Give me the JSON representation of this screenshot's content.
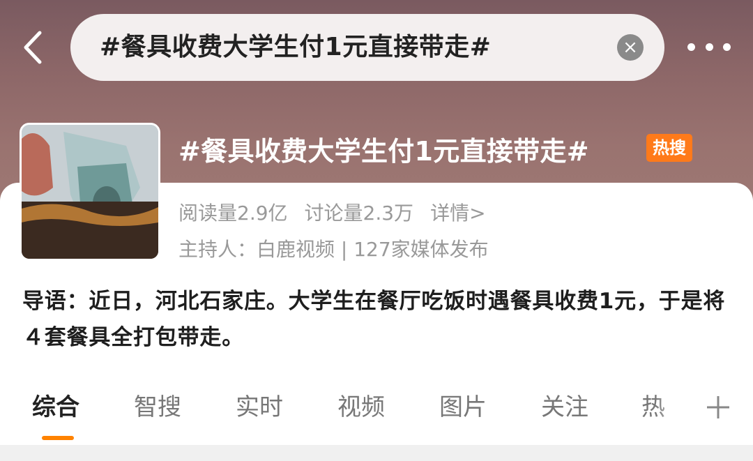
{
  "header": {
    "search_query": "#餐具收费大学生付1元直接带走#",
    "back_icon": "chevron-left-icon",
    "clear_icon": "close-icon",
    "clear_glyph": "×",
    "more_icon": "more-dots-icon"
  },
  "topic": {
    "title": "#餐具收费大学生付1元直接带走#",
    "badge": "热搜",
    "reads": "阅读量2.9亿",
    "discussions": "讨论量2.3万",
    "details_link": "详情>",
    "host": "主持人：白鹿视频 | 127家媒体发布",
    "intro": "导语：近日，河北石家庄。大学生在餐厅吃饭时遇餐具收费1元，于是将４套餐具全打包带走。"
  },
  "tabs": [
    {
      "label": "综合",
      "active": true
    },
    {
      "label": "智搜",
      "active": false
    },
    {
      "label": "实时",
      "active": false
    },
    {
      "label": "视频",
      "active": false
    },
    {
      "label": "图片",
      "active": false
    },
    {
      "label": "关注",
      "active": false
    },
    {
      "label": "热",
      "active": false
    }
  ],
  "add_tab_icon": "plus-icon",
  "colors": {
    "accent": "#ff8200",
    "badge": "#ff7a1a",
    "hero": "#8d6768"
  }
}
